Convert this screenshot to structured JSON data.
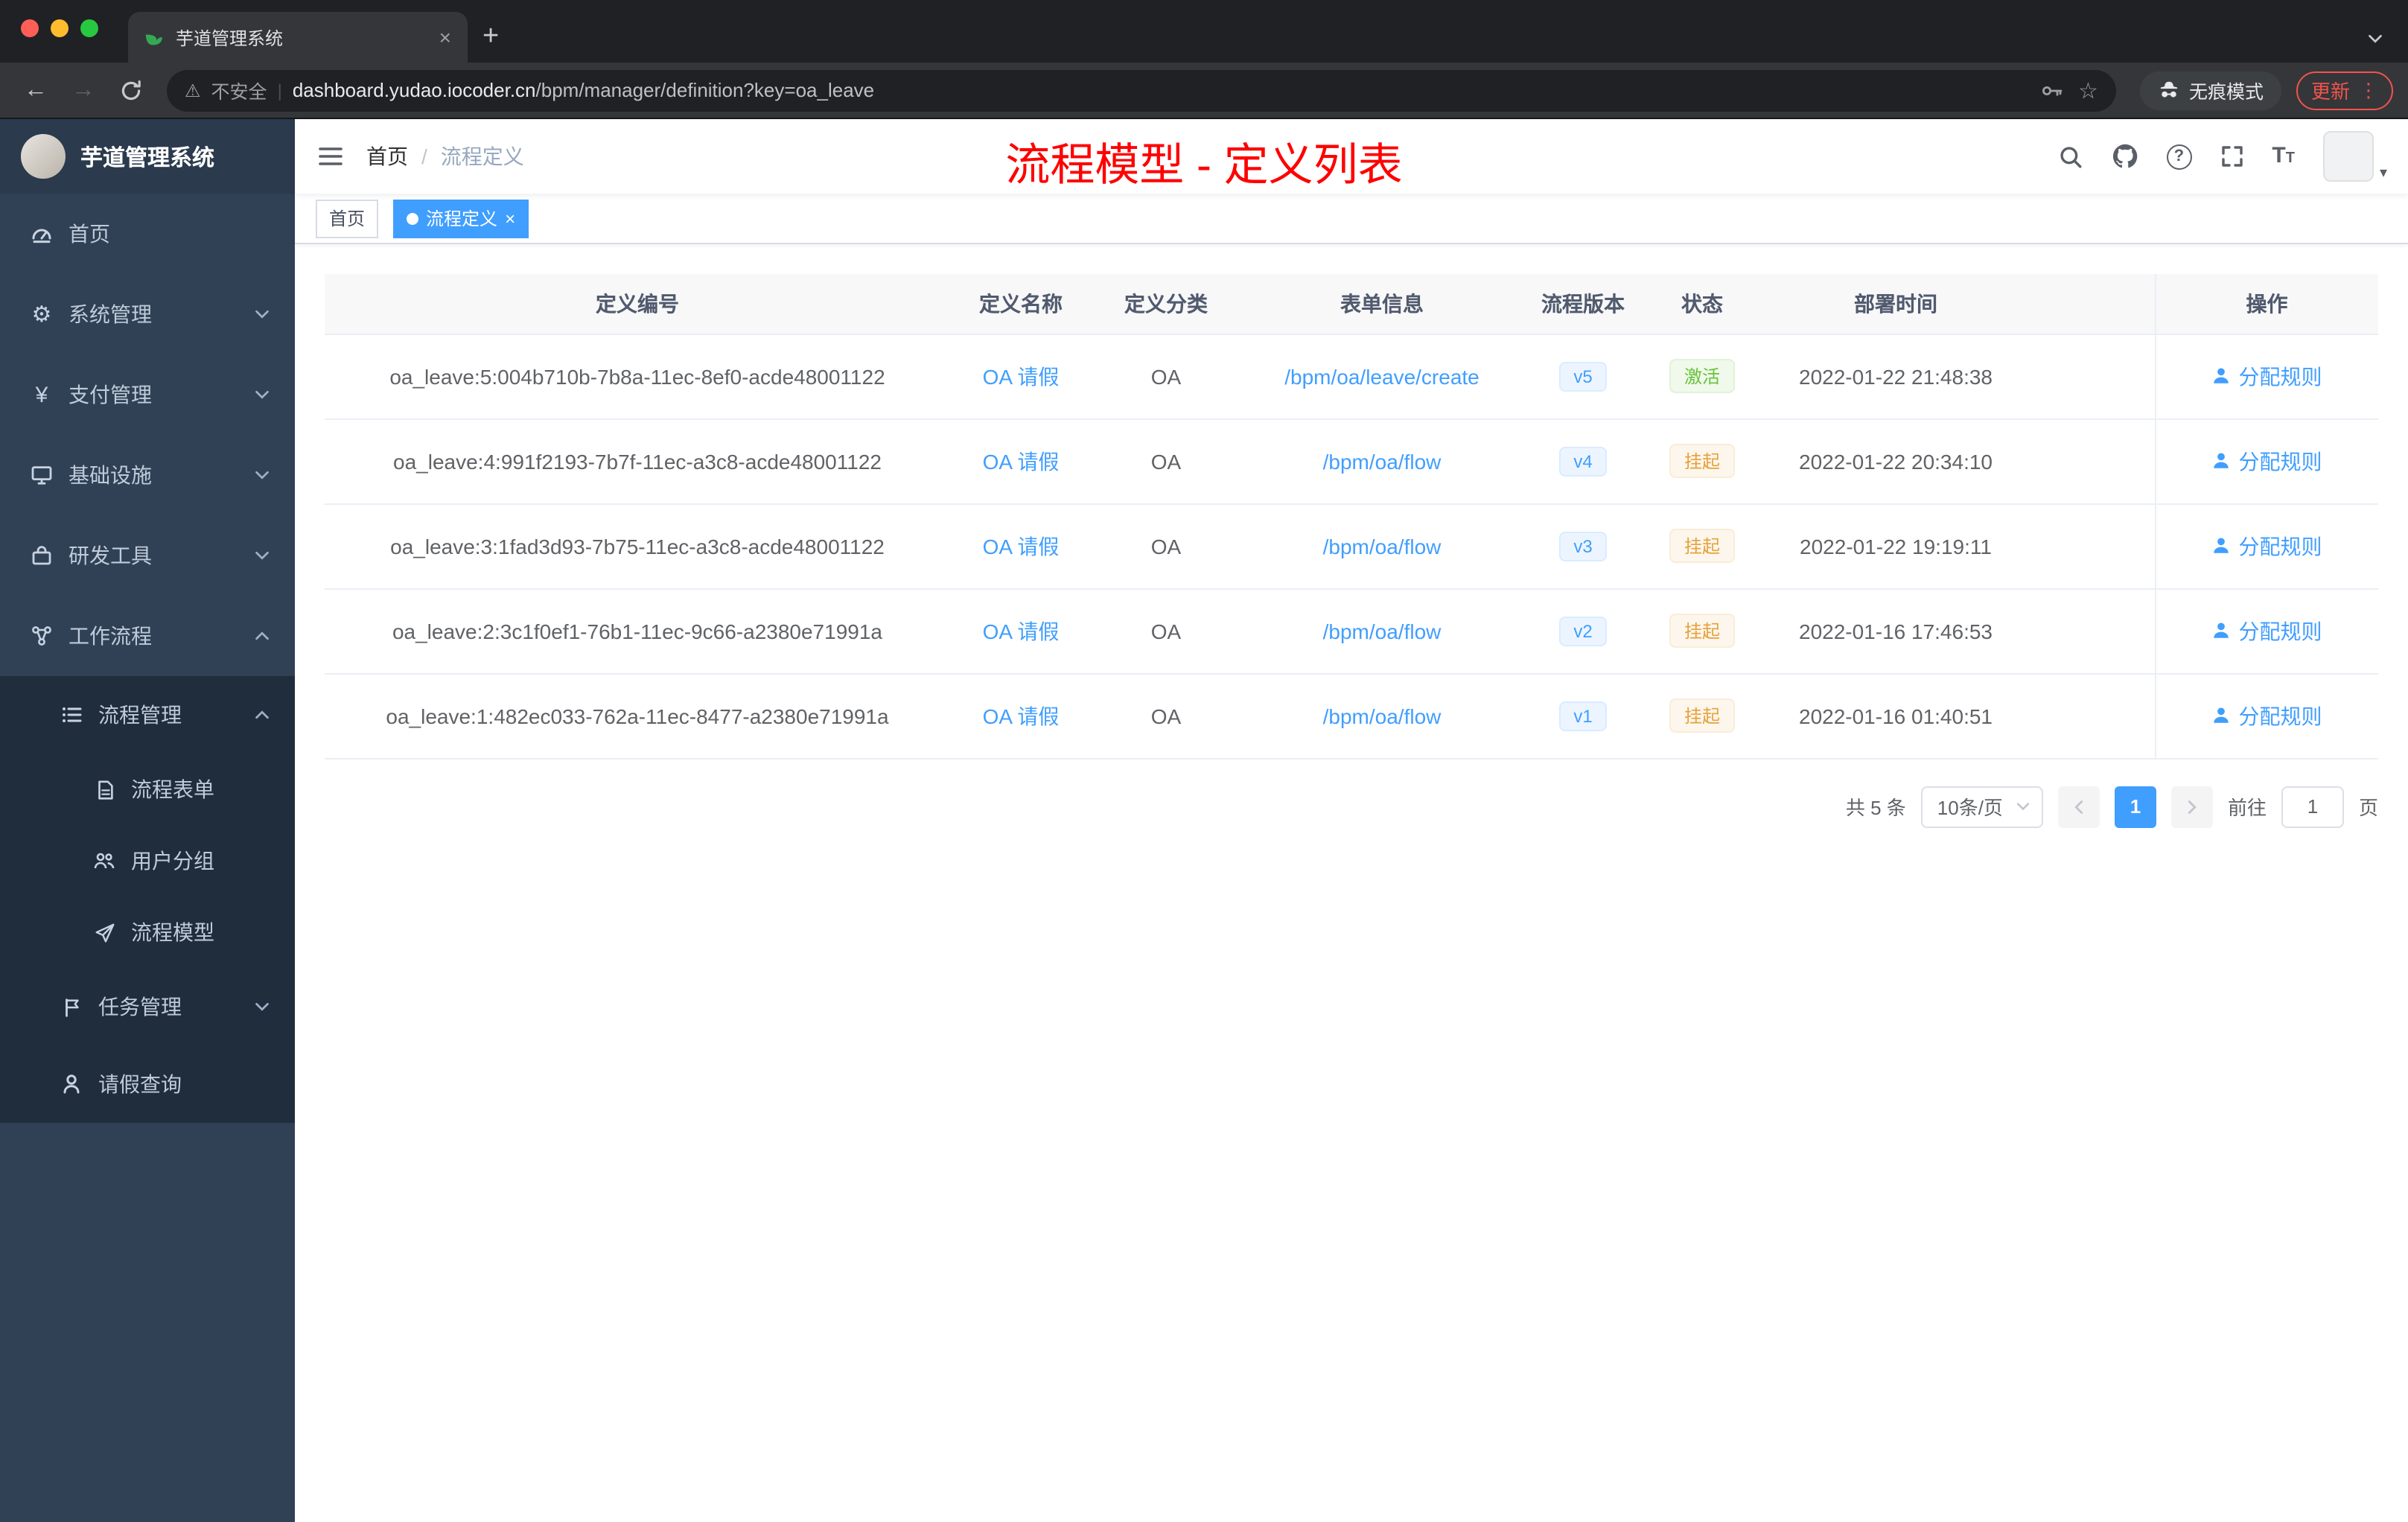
{
  "browser": {
    "tab_title": "芋道管理系统",
    "security_label": "不安全",
    "url_domain": "dashboard.yudao.iocoder.cn",
    "url_path": "/bpm/manager/definition?key=oa_leave",
    "incognito_label": "无痕模式",
    "update_label": "更新"
  },
  "icons": {
    "tab_close_glyph": "×",
    "new_tab_glyph": "+",
    "back_glyph": "←",
    "forward_glyph": "→",
    "warning_glyph": "⚠",
    "url_divider_glyph": "|",
    "star_glyph": "☆",
    "menu_dots_glyph": "⋮",
    "gear_glyph": "⚙",
    "yen_glyph": "¥",
    "question_glyph": "?",
    "font_size_glyph": "T",
    "avatar_caret_glyph": "▾",
    "tag_close_glyph": "×"
  },
  "sidebar": {
    "logo_title": "芋道管理系统",
    "items": [
      {
        "label": "首页"
      },
      {
        "label": "系统管理"
      },
      {
        "label": "支付管理"
      },
      {
        "label": "基础设施"
      },
      {
        "label": "研发工具"
      },
      {
        "label": "工作流程"
      },
      {
        "label": "流程管理"
      },
      {
        "label": "流程表单"
      },
      {
        "label": "用户分组"
      },
      {
        "label": "流程模型"
      },
      {
        "label": "任务管理"
      },
      {
        "label": "请假查询"
      }
    ]
  },
  "header": {
    "breadcrumb_home": "首页",
    "breadcrumb_sep": "/",
    "breadcrumb_current": "流程定义",
    "annotation": "流程模型 - 定义列表"
  },
  "tags": {
    "home": "首页",
    "active": "流程定义"
  },
  "table": {
    "columns": {
      "id": "定义编号",
      "name": "定义名称",
      "category": "定义分类",
      "form": "表单信息",
      "version": "流程版本",
      "status": "状态",
      "deploy_time": "部署时间",
      "action": "操作"
    },
    "rows": [
      {
        "id": "oa_leave:5:004b710b-7b8a-11ec-8ef0-acde48001122",
        "name": "OA 请假",
        "category": "OA",
        "form": "/bpm/oa/leave/create",
        "version": "v5",
        "status": "激活",
        "deploy_time": "2022-01-22 21:48:38",
        "action": "分配规则"
      },
      {
        "id": "oa_leave:4:991f2193-7b7f-11ec-a3c8-acde48001122",
        "name": "OA 请假",
        "category": "OA",
        "form": "/bpm/oa/flow",
        "version": "v4",
        "status": "挂起",
        "deploy_time": "2022-01-22 20:34:10",
        "action": "分配规则"
      },
      {
        "id": "oa_leave:3:1fad3d93-7b75-11ec-a3c8-acde48001122",
        "name": "OA 请假",
        "category": "OA",
        "form": "/bpm/oa/flow",
        "version": "v3",
        "status": "挂起",
        "deploy_time": "2022-01-22 19:19:11",
        "action": "分配规则"
      },
      {
        "id": "oa_leave:2:3c1f0ef1-76b1-11ec-9c66-a2380e71991a",
        "name": "OA 请假",
        "category": "OA",
        "form": "/bpm/oa/flow",
        "version": "v2",
        "status": "挂起",
        "deploy_time": "2022-01-16 17:46:53",
        "action": "分配规则"
      },
      {
        "id": "oa_leave:1:482ec033-762a-11ec-8477-a2380e71991a",
        "name": "OA 请假",
        "category": "OA",
        "form": "/bpm/oa/flow",
        "version": "v1",
        "status": "挂起",
        "deploy_time": "2022-01-16 01:40:51",
        "action": "分配规则"
      }
    ]
  },
  "pagination": {
    "total": "共 5 条",
    "page_size": "10条/页",
    "current_page": "1",
    "goto_label": "前往",
    "goto_value": "1",
    "page_unit": "页"
  },
  "colors": {
    "accent": "#409eff",
    "success": "#67c23a",
    "warning": "#e6a23c",
    "annotation": "#ff0000",
    "sidebar_bg": "#304156",
    "submenu_bg": "#1f2d3d",
    "active_tag_bg": "#409eff"
  }
}
